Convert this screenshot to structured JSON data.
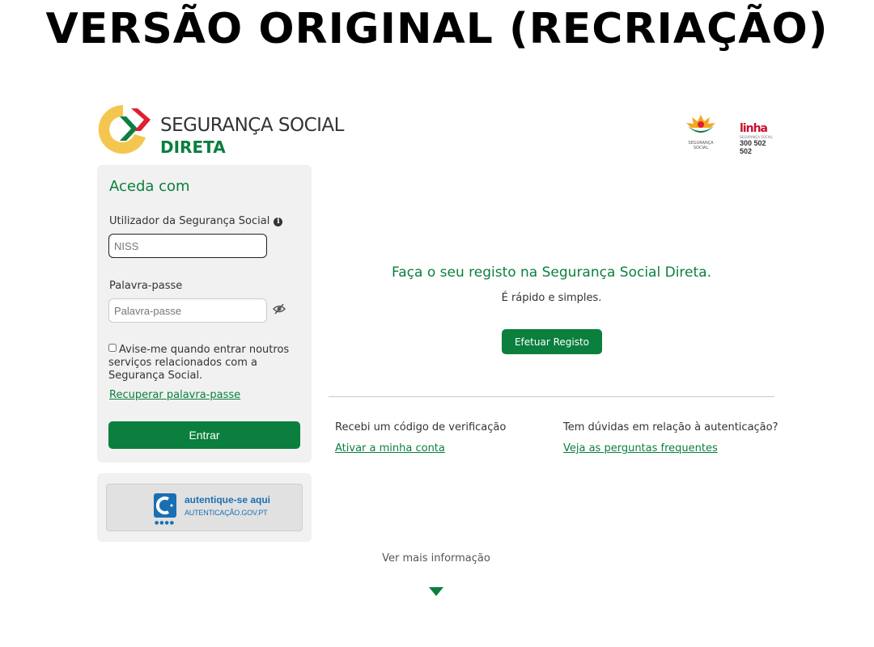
{
  "banner": {
    "title": "VERSÃO ORIGINAL (RECRIAÇÃO)"
  },
  "header": {
    "logo_line1": "SEGURANÇA SOCIAL",
    "logo_line2": "DIRETA",
    "seguranca_caption": "SEGURANÇA SOCIAL",
    "linha_word": "linha",
    "linha_sub": "SEGURANÇA SOCIAL",
    "linha_number": "300 502 502"
  },
  "login": {
    "title": "Aceda com",
    "user_label": "Utilizador da Segurança Social",
    "user_placeholder": "NISS",
    "password_label": "Palavra-passe",
    "password_placeholder": "Palavra-passe",
    "remember_text": "Avise-me quando entrar noutros serviços relacionados com a Segurança Social.",
    "recover_link": "Recuperar palavra-passe",
    "enter_button": "Entrar"
  },
  "auth_gov": {
    "title": "autentique-se aqui",
    "subtitle": "AUTENTICAÇÃO.GOV.PT"
  },
  "register": {
    "title": "Faça o seu registo na Segurança Social Direta.",
    "subtitle": "É rápido e simples.",
    "button": "Efetuar Registo"
  },
  "help": {
    "col1_text": "Recebi um código de verificação",
    "col1_link": "Ativar a minha conta",
    "col2_text": "Tem dúvidas em relação à autenticação?",
    "col2_link": "Veja as perguntas frequentes"
  },
  "footer": {
    "more_info": "Ver mais informação"
  },
  "colors": {
    "brand_green": "#0b7f3d",
    "brand_yellow": "#f5c64f",
    "brand_red": "#e0202e",
    "auth_blue": "#1a6fb3"
  }
}
